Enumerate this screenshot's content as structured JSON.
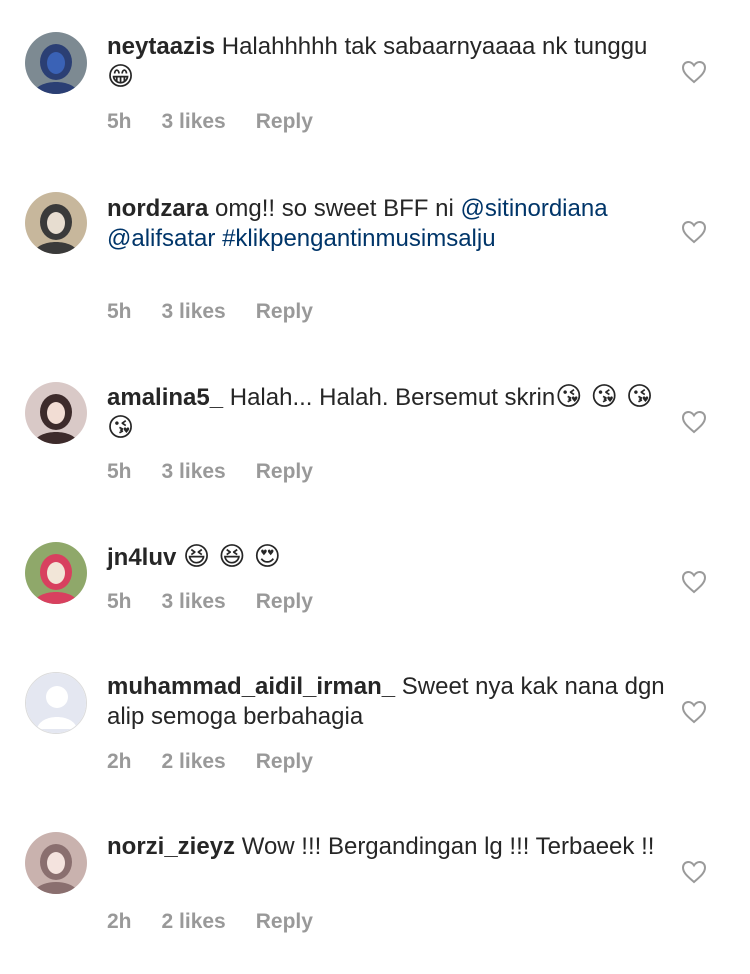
{
  "comments": [
    {
      "username": "neytaazis",
      "text_parts": [
        {
          "text": "Halahhhhh tak sabaarnyaaaa  nk tunggu "
        }
      ],
      "emoji": "😁",
      "time": "5h",
      "likes": "3 likes",
      "reply": "Reply",
      "avatar_colors": [
        "#7d8a92",
        "#2b3f74",
        "#3a62b6"
      ]
    },
    {
      "username": "nordzara",
      "text_parts": [
        {
          "text": "omg!! so sweet BFF ni "
        },
        {
          "text": "@sitinordiana",
          "tag": true
        },
        {
          "text": " "
        },
        {
          "text": "@alifsatar",
          "tag": true
        },
        {
          "text": " "
        },
        {
          "text": "#klikpengantinmusimsalju",
          "tag": true
        }
      ],
      "emoji": "",
      "time": "5h",
      "likes": "3 likes",
      "reply": "Reply",
      "avatar_colors": [
        "#c7b79c",
        "#3a3a3a",
        "#e7ddd0"
      ]
    },
    {
      "username": "amalina5_",
      "text_parts": [
        {
          "text": "Halah... Halah. Bersemut skrin"
        }
      ],
      "emoji": "😘 😘 😘 😘",
      "time": "5h",
      "likes": "3 likes",
      "reply": "Reply",
      "avatar_colors": [
        "#d9c9c7",
        "#3d2b2b",
        "#f2ddd4"
      ]
    },
    {
      "username": "jn4luv",
      "text_parts": [
        {
          "text": ""
        }
      ],
      "emoji": "😆 😆 😍",
      "time": "5h",
      "likes": "3 likes",
      "reply": "Reply",
      "avatar_colors": [
        "#8fa86a",
        "#d8405f",
        "#f2e6d8"
      ]
    },
    {
      "username": "muhammad_aidil_irman_",
      "text_parts": [
        {
          "text": "Sweet nya kak nana dgn alip semoga berbahagia"
        }
      ],
      "emoji": "",
      "time": "2h",
      "likes": "2 likes",
      "reply": "Reply",
      "avatar_colors": [
        "#e4e7f1",
        "#c0c6dd",
        "#ffffff"
      ]
    },
    {
      "username": "norzi_zieyz",
      "text_parts": [
        {
          "text": "Wow !!! Bergandingan lg !!! Terbaeek !!"
        }
      ],
      "emoji": "",
      "time": "2h",
      "likes": "2 likes",
      "reply": "Reply",
      "avatar_colors": [
        "#c9b2ae",
        "#8a6f6f",
        "#f4e3de"
      ]
    }
  ]
}
